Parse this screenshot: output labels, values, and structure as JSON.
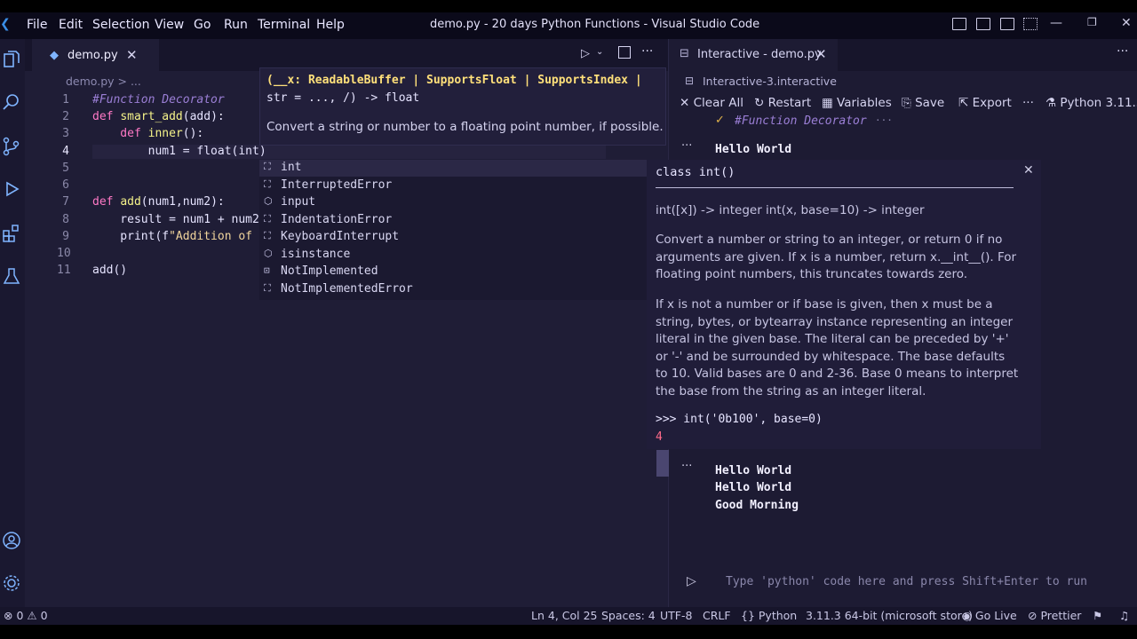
{
  "window": {
    "title": "demo.py - 20 days Python Functions - Visual Studio Code",
    "menu": [
      "File",
      "Edit",
      "Selection",
      "View",
      "Go",
      "Run",
      "Terminal",
      "Help"
    ]
  },
  "editor": {
    "tab_label": "demo.py",
    "breadcrumb": "demo.py > ...",
    "line_numbers": [
      "1",
      "2",
      "3",
      "4",
      "5",
      "6",
      "7",
      "8",
      "9",
      "10",
      "11"
    ],
    "lines": {
      "l1": "#Function Decorator",
      "l2a": "def ",
      "l2b": "smart_add",
      "l2c": "(add):",
      "l3a": "    def ",
      "l3b": "inner",
      "l3c": "():",
      "l4": "        num1 = float(int)",
      "l7a": "def ",
      "l7b": "add",
      "l7c": "(num1,num2):",
      "l8": "    result = num1 + num2",
      "l9a": "    print(f",
      "l9b": "\"Addition of",
      "l11": "add()"
    }
  },
  "hover": {
    "signature_line1": "(__x: ReadableBuffer | SupportsFloat | SupportsIndex |",
    "signature_line2": "str = ..., /) -> float",
    "description": "Convert a string or number to a floating point number, if possible."
  },
  "suggestions": [
    {
      "label": "int",
      "icon": "class-icon"
    },
    {
      "label": "InterruptedError",
      "icon": "class-icon"
    },
    {
      "label": "input",
      "icon": "function-icon"
    },
    {
      "label": "IndentationError",
      "icon": "class-icon"
    },
    {
      "label": "KeyboardInterrupt",
      "icon": "class-icon"
    },
    {
      "label": "isinstance",
      "icon": "function-icon"
    },
    {
      "label": "NotImplemented",
      "icon": "variable-icon"
    },
    {
      "label": "NotImplementedError",
      "icon": "class-icon"
    }
  ],
  "details": {
    "class_sig": "class int()",
    "sig": "int([x]) -> integer int(x, base=10) -> integer",
    "para1": "Convert a number or string to an integer, or return 0 if no arguments are given. If x is a number, return x.__int__(). For floating point numbers, this truncates towards zero.",
    "para2": "If x is not a number or if base is given, then x must be a string, bytes, or bytearray instance representing an integer literal in the given base. The literal can be preceded by '+' or '-' and be surrounded by whitespace. The base defaults to 10. Valid bases are 0 and 2-36. Base 0 means to interpret the base from the string as an integer literal.",
    "example": ">>> int('0b100', base=0)",
    "example_output": "4"
  },
  "interactive": {
    "tab_label": "Interactive - demo.py",
    "subtitle": "Interactive-3.interactive",
    "toolbar": {
      "clear_all": "Clear All",
      "restart": "Restart",
      "variables": "Variables",
      "save": "Save",
      "export": "Export",
      "more": "···",
      "kernel": "Python 3.11.3"
    },
    "cell1_code": "#Function Decorator",
    "cell1_output": "Hello World",
    "cell2_output": [
      "Hello World",
      "Hello World",
      "Good Morning"
    ],
    "input_placeholder": "Type 'python' code here and press Shift+Enter to run"
  },
  "statusbar": {
    "errors": "0",
    "warnings": "0",
    "position": "Ln 4, Col 25",
    "spaces": "Spaces: 4",
    "encoding": "UTF-8",
    "eol": "CRLF",
    "language": "Python",
    "interpreter": "3.11.3 64-bit (microsoft store)",
    "go_live": "Go Live",
    "prettier": "Prettier"
  },
  "colors": {
    "background": "#1f1d36",
    "keyword": "#ff79c6",
    "function": "#f5f38a",
    "comment": "#9b7fd6",
    "accent_output": "#ff6b8a"
  }
}
